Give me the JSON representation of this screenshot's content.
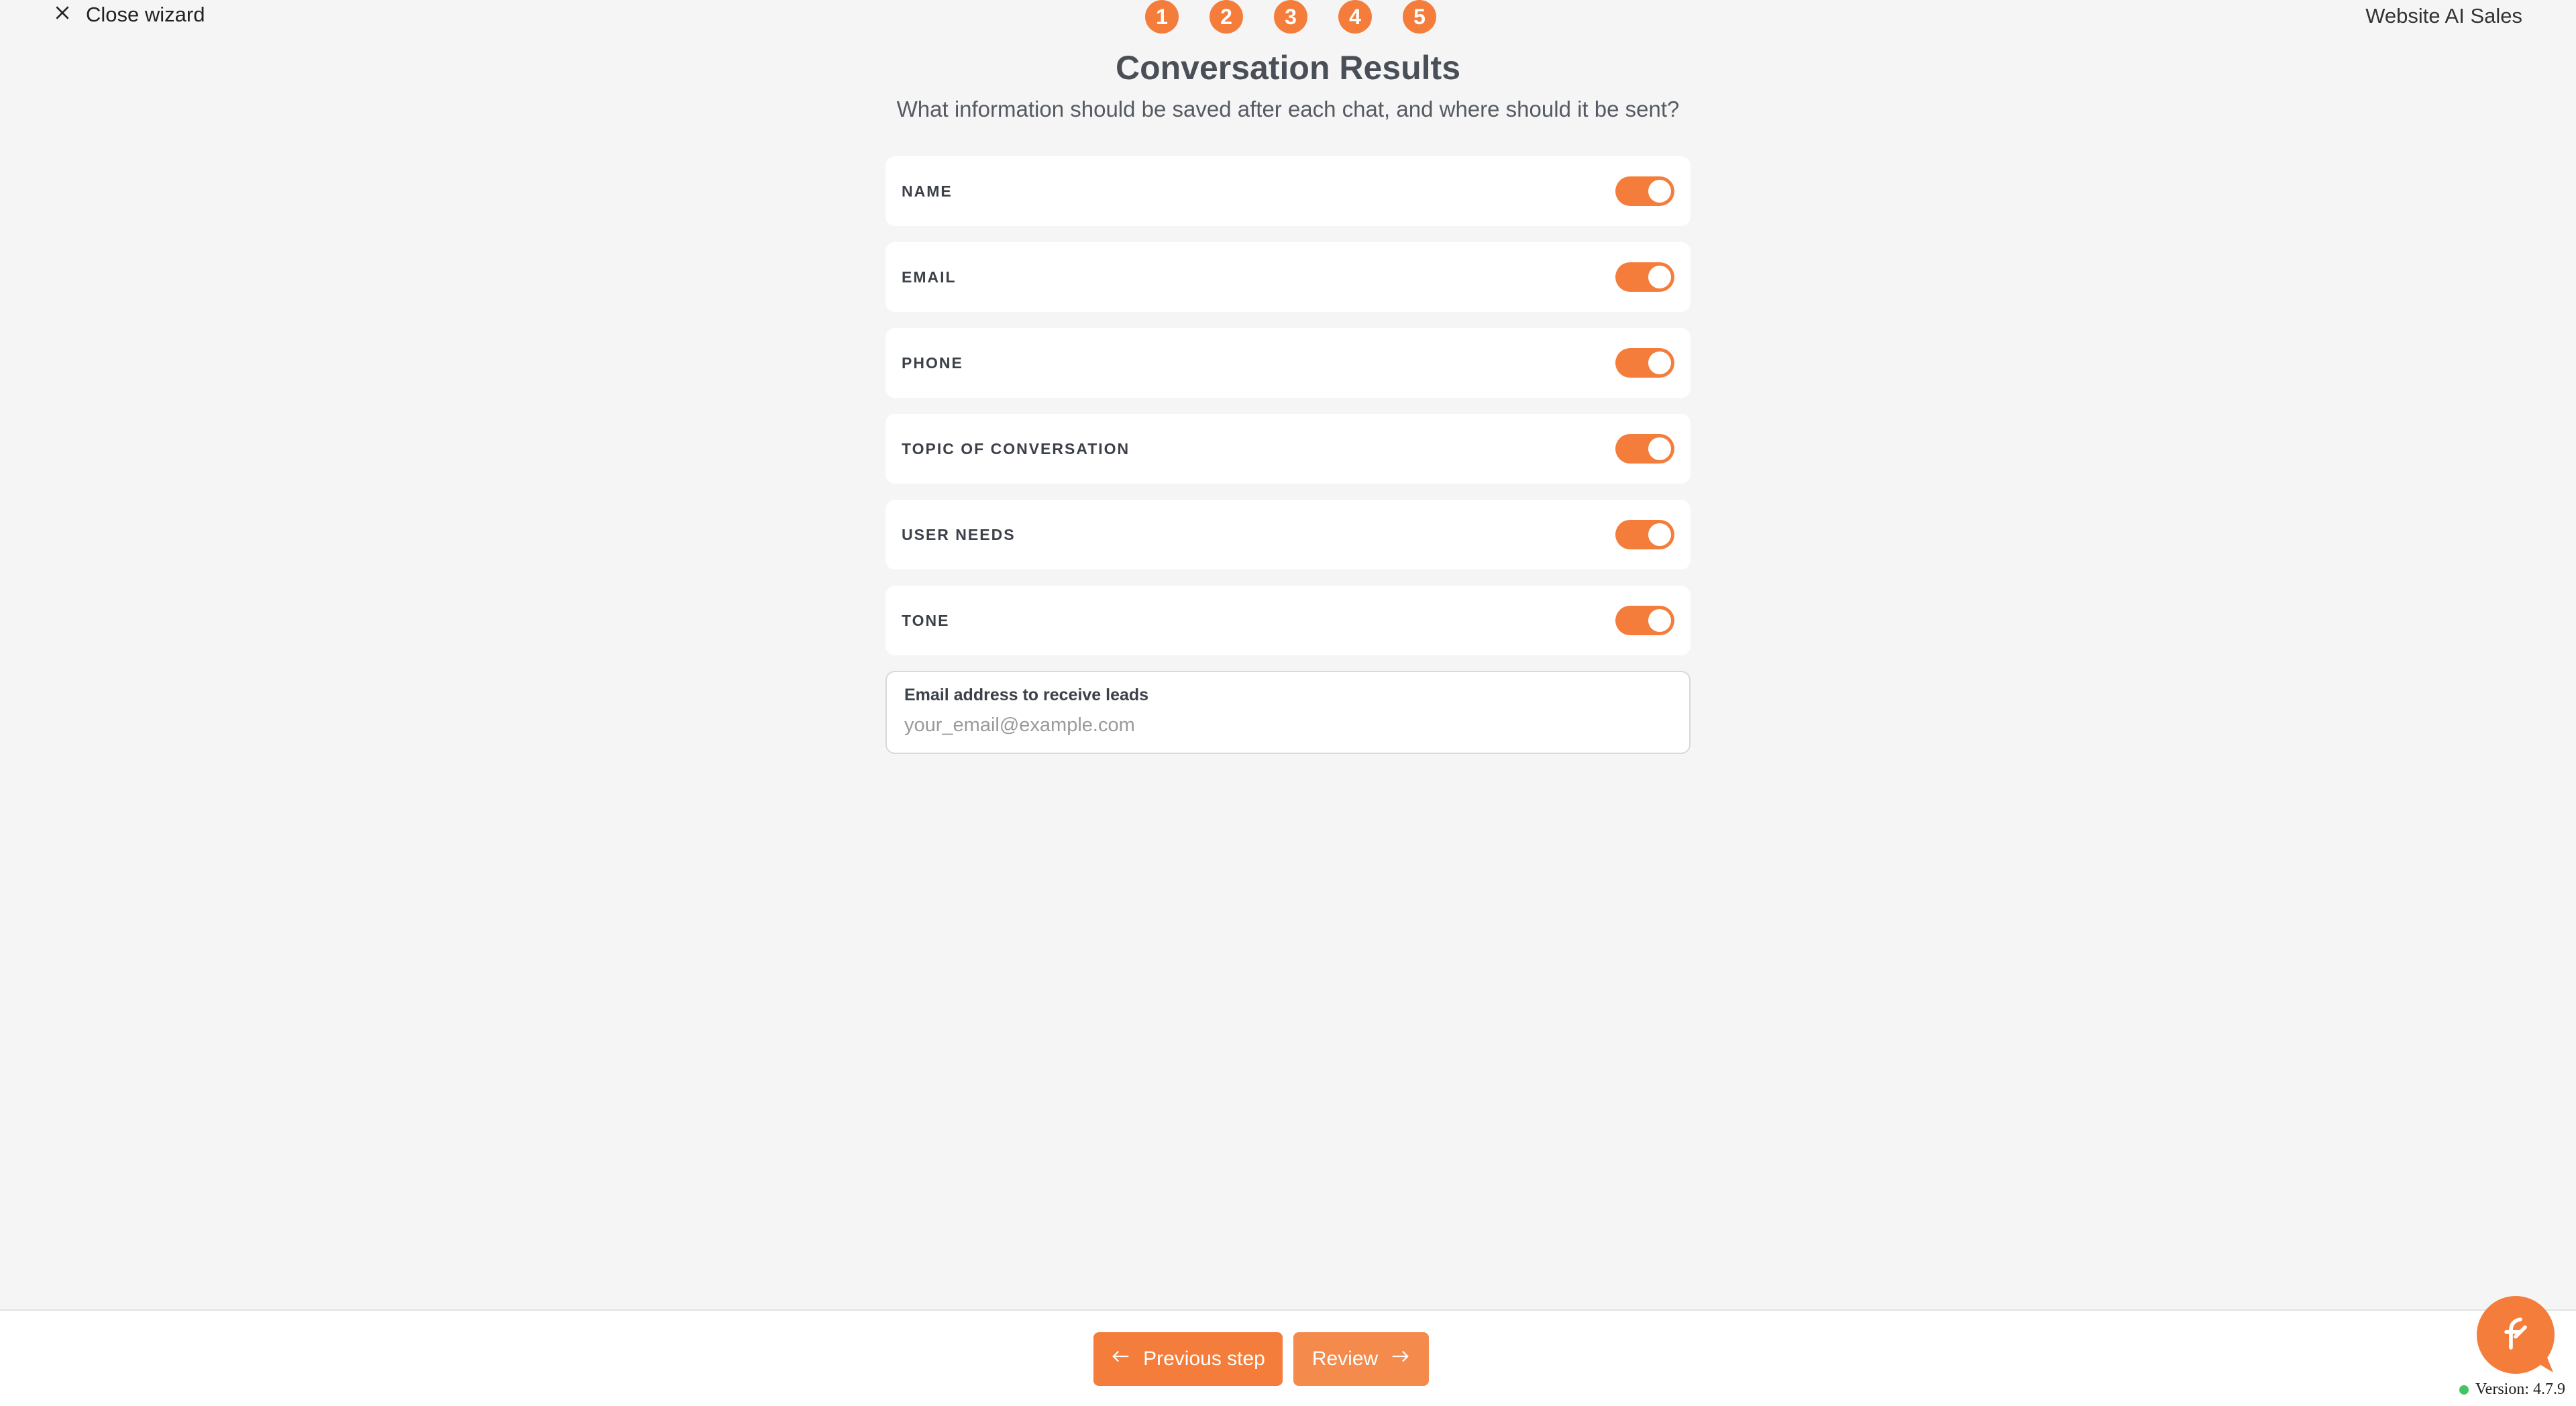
{
  "header": {
    "close_label": "Close wizard",
    "app_name": "Website AI Sales",
    "steps": [
      "1",
      "2",
      "3",
      "4",
      "5"
    ]
  },
  "main": {
    "title": "Conversation Results",
    "subtitle": "What information should be saved after each chat, and where should it be sent?",
    "fields": [
      {
        "label": "NAME",
        "enabled": true
      },
      {
        "label": "EMAIL",
        "enabled": true
      },
      {
        "label": "PHONE",
        "enabled": true
      },
      {
        "label": "TOPIC OF CONVERSATION",
        "enabled": true
      },
      {
        "label": "USER NEEDS",
        "enabled": true
      },
      {
        "label": "TONE",
        "enabled": true
      }
    ],
    "email": {
      "label": "Email address to receive leads",
      "value": "",
      "placeholder": "your_email@example.com"
    }
  },
  "footer": {
    "prev_label": "Previous step",
    "next_label": "Review",
    "version": "Version: 4.7.9"
  },
  "colors": {
    "accent": "#f47d3b",
    "status_online": "#43c463"
  },
  "icons": {
    "close": "close-icon",
    "prev": "arrow-left-icon",
    "next": "arrow-right-icon",
    "chat": "chat-bubble-icon"
  }
}
